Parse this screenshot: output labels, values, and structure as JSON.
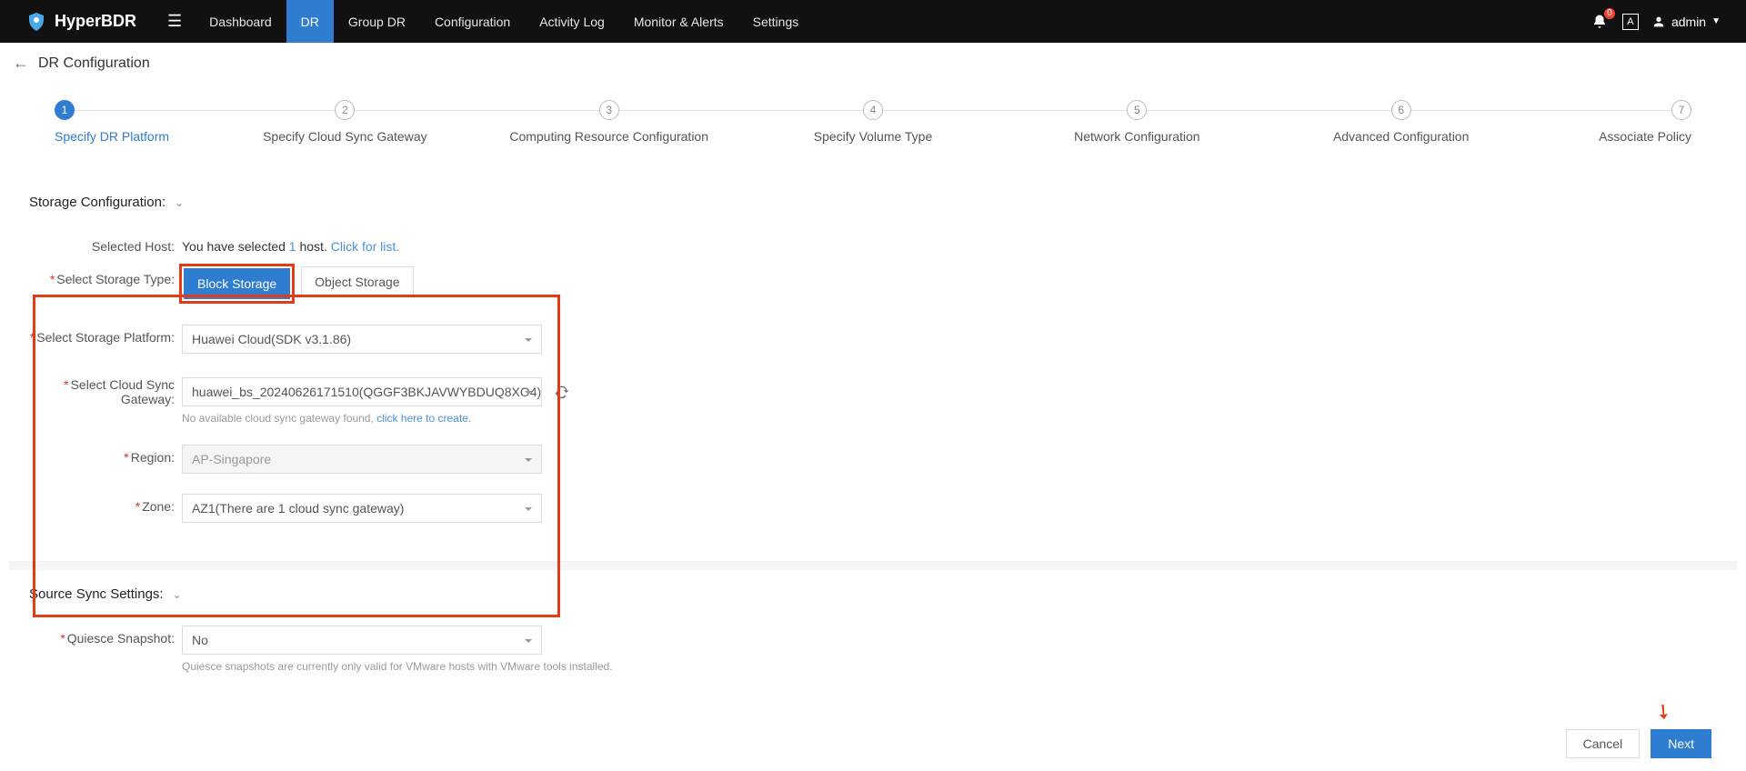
{
  "brand": "HyperBDR",
  "nav": {
    "items": [
      "Dashboard",
      "DR",
      "Group DR",
      "Configuration",
      "Activity Log",
      "Monitor & Alerts",
      "Settings"
    ],
    "active_index": 1
  },
  "topright": {
    "notif_count": "0",
    "lang_badge": "A",
    "user": "admin"
  },
  "page_title": "DR Configuration",
  "steps": {
    "items": [
      "Specify DR Platform",
      "Specify Cloud Sync Gateway",
      "Computing Resource Configuration",
      "Specify Volume Type",
      "Network Configuration",
      "Advanced Configuration",
      "Associate Policy"
    ],
    "active_index": 0
  },
  "storage": {
    "section_title": "Storage Configuration:",
    "selected_host_label": "Selected Host:",
    "selected_host_text_a": "You have selected ",
    "selected_host_count": "1",
    "selected_host_text_b": " host. ",
    "selected_host_link": "Click for list",
    "select_storage_type_label": "Select Storage Type:",
    "storage_type_block": "Block Storage",
    "storage_type_object": "Object Storage",
    "select_storage_platform_label": "Select Storage Platform:",
    "storage_platform_value": "Huawei Cloud(SDK v3.1.86)",
    "select_cloud_sync_gateway_label_a": "Select Cloud Sync",
    "select_cloud_sync_gateway_label_b": "Gateway:",
    "cloud_sync_gateway_value": "huawei_bs_20240626171510(QGGF3BKJAVWYBDUQ8XO4)",
    "gateway_hint_a": "No available cloud sync gateway found, ",
    "gateway_hint_link": "click here to create",
    "region_label": "Region:",
    "region_value": "AP-Singapore",
    "zone_label": "Zone:",
    "zone_value": "AZ1(There are 1 cloud sync gateway)"
  },
  "sync": {
    "section_title": "Source Sync Settings:",
    "quiesce_label": "Quiesce Snapshot:",
    "quiesce_value": "No",
    "quiesce_hint": "Quiesce snapshots are currently only valid for VMware hosts with VMware tools installed."
  },
  "footer": {
    "cancel": "Cancel",
    "next": "Next"
  }
}
